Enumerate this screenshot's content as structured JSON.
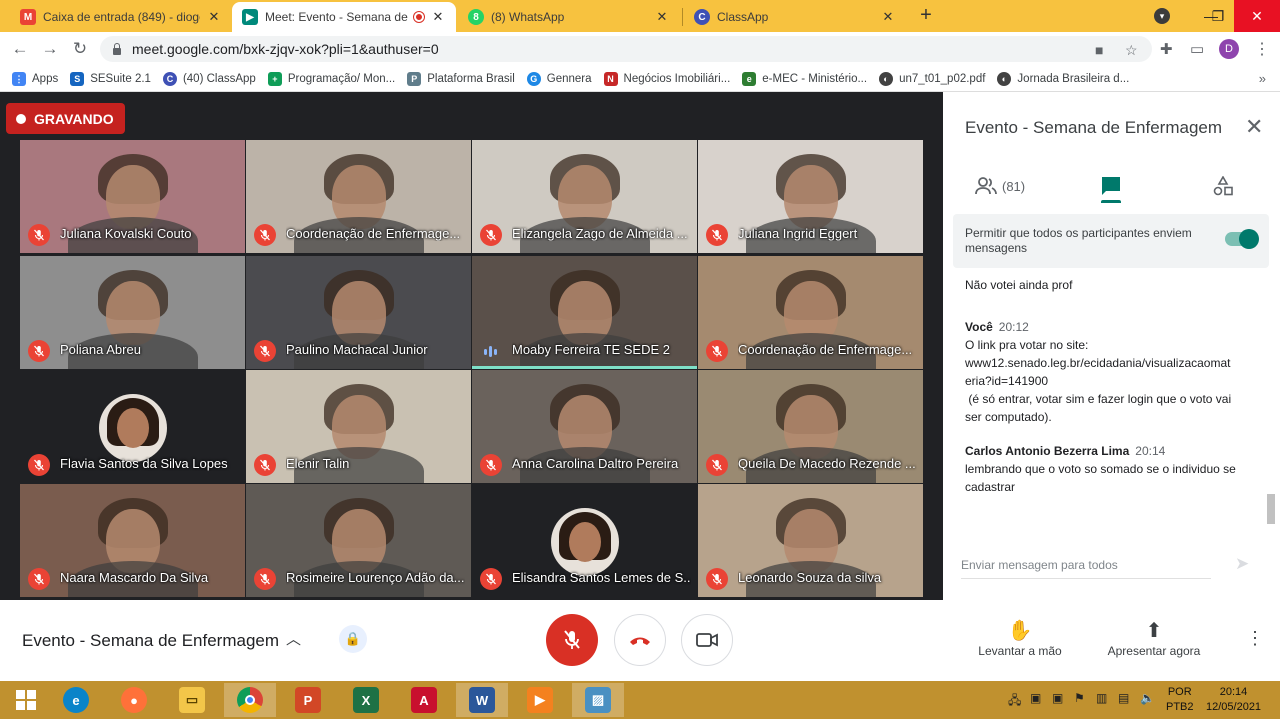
{
  "browser": {
    "tabs": [
      {
        "title": "Caixa de entrada (849) - diogene",
        "favicon": "gmail-icon",
        "color": "#ea4335"
      },
      {
        "title": "Meet: Evento - Semana de E",
        "favicon": "meet-icon",
        "color": "#00897b"
      },
      {
        "title": "(8) WhatsApp",
        "favicon": "whatsapp-icon",
        "color": "#25d366"
      },
      {
        "title": "ClassApp",
        "favicon": "classapp-icon",
        "color": "#3f51b5"
      }
    ],
    "url": "meet.google.com/bxk-zjqv-xok?pli=1&authuser=0",
    "profile_initial": "D",
    "bookmarks": [
      {
        "label": "Apps",
        "color": "#4285f4"
      },
      {
        "label": "SESuite 2.1",
        "color": "#1565c0"
      },
      {
        "label": "(40) ClassApp",
        "color": "#3f51b5"
      },
      {
        "label": "Programação/ Mon...",
        "color": "#0f9d58"
      },
      {
        "label": "Plataforma Brasil",
        "color": "#607d8b"
      },
      {
        "label": "Gennera",
        "color": "#1e88e5"
      },
      {
        "label": "Negócios Imobiliári...",
        "color": "#c62828"
      },
      {
        "label": "e-MEC - Ministério...",
        "color": "#2e7d32"
      },
      {
        "label": "un7_t01_p02.pdf",
        "color": "#424242"
      },
      {
        "label": "Jornada Brasileira d...",
        "color": "#424242"
      }
    ]
  },
  "meet": {
    "recording_label": "GRAVANDO",
    "participants": [
      {
        "name": "Juliana Kovalski Couto",
        "muted": true,
        "bg": "#a9787e"
      },
      {
        "name": "Coordenação de Enfermage...",
        "muted": true,
        "bg": "#bcb3a8"
      },
      {
        "name": "Elizangela Zago de Almeida ...",
        "muted": true,
        "bg": "#cfcac2"
      },
      {
        "name": "Juliana Ingrid Eggert",
        "muted": true,
        "bg": "#d8d2cc"
      },
      {
        "name": "Poliana Abreu",
        "muted": true,
        "bg": "#8e8e8e"
      },
      {
        "name": "Paulino Machacal Junior",
        "muted": true,
        "bg": "#4b4b4f"
      },
      {
        "name": "Moaby Ferreira TE SEDE 2",
        "muted": false,
        "speaking": true,
        "bg": "#5a504a"
      },
      {
        "name": "Coordenação de Enfermage...",
        "muted": true,
        "bg": "#a58a6f"
      },
      {
        "name": "Flavia Santos da Silva Lopes",
        "muted": true,
        "avatar": true,
        "bg": "#202124"
      },
      {
        "name": "Elenir Talin",
        "muted": true,
        "bg": "#c9c1b2"
      },
      {
        "name": "Anna Carolina Daltro Pereira",
        "muted": true,
        "bg": "#6a625c"
      },
      {
        "name": "Queila De Macedo Rezende ...",
        "muted": true,
        "bg": "#9a8a72"
      },
      {
        "name": "Naara Mascardo Da Silva",
        "muted": true,
        "bg": "#7a5c4e"
      },
      {
        "name": "Rosimeire Lourenço Adão da...",
        "muted": true,
        "bg": "#5f5a55"
      },
      {
        "name": "Elisandra Santos Lemes de S...",
        "muted": true,
        "avatar": true,
        "bg": "#202124"
      },
      {
        "name": "Leonardo Souza da silva",
        "muted": true,
        "bg": "#b7a38c"
      }
    ],
    "meeting_title": "Evento - Semana de Enfermagem",
    "raise_hand_label": "Levantar a mão",
    "present_label": "Apresentar agora"
  },
  "panel": {
    "title": "Evento - Semana de Enfermagem",
    "people_count": "(81)",
    "allow_messages_label": "Permitir que todos os participantes enviem mensagens",
    "allow_messages_enabled": true,
    "partial_message": "Não votei ainda prof",
    "messages": [
      {
        "sender": "Você",
        "time": "20:12",
        "lines": [
          "O link pra votar no site:",
          "www12.senado.leg.br/ecidadania/visualizacaomat",
          "eria?id=141900",
          " (é só entrar, votar sim e fazer login que o voto vai",
          "ser computado)."
        ]
      },
      {
        "sender": "Carlos Antonio Bezerra Lima",
        "time": "20:14",
        "lines": [
          "lembrando que o voto so somado se o individuo se",
          "cadastrar"
        ]
      }
    ],
    "input_placeholder": "Enviar mensagem para todos"
  },
  "taskbar": {
    "language": "POR",
    "language_sub": "PTB2",
    "time": "20:14",
    "date": "12/05/2021"
  }
}
